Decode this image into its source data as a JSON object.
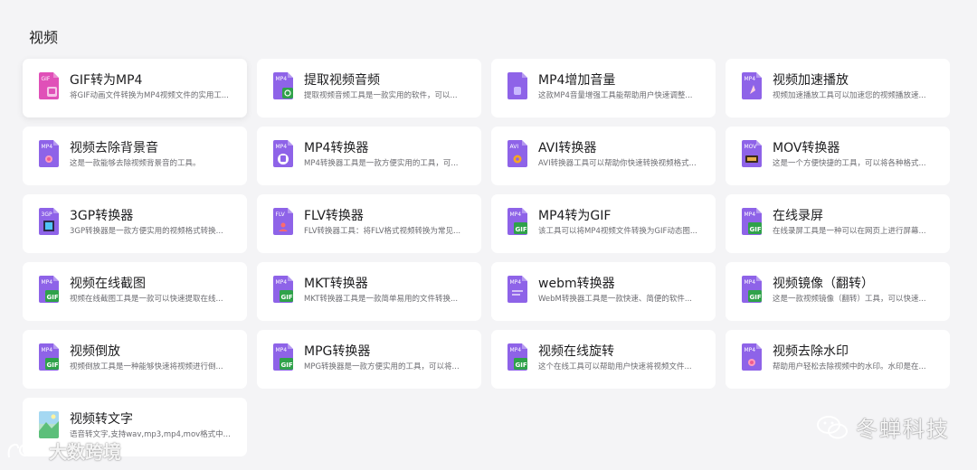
{
  "section": {
    "title": "视频"
  },
  "tools": [
    {
      "title": "GIF转为MP4",
      "desc": "将GIF动画文件转换为MP4视频文件的实用工...",
      "icon": "gif-to-mp4-icon",
      "badge": "GIF",
      "variant": "pink"
    },
    {
      "title": "提取视频音频",
      "desc": "提取视频音频工具是一款实用的软件，可以...",
      "icon": "extract-audio-icon",
      "badge": "MP4",
      "variant": "green-mark"
    },
    {
      "title": "MP4增加音量",
      "desc": "这款MP4音量增强工具能帮助用户快速调整...",
      "icon": "mp4-volume-icon",
      "badge": "",
      "variant": "volume"
    },
    {
      "title": "视频加速播放",
      "desc": "视频加速播放工具可以加速您的视频播放速...",
      "icon": "video-speed-icon",
      "badge": "MP4",
      "variant": "rocket"
    },
    {
      "title": "视频去除背景音",
      "desc": "这是一款能够去除视频背景音的工具。",
      "icon": "remove-bg-audio-icon",
      "badge": "MP4",
      "variant": "dot"
    },
    {
      "title": "MP4转换器",
      "desc": "MP4转换器工具是一款方便实用的工具，可...",
      "icon": "mp4-converter-icon",
      "badge": "MP4",
      "variant": "round"
    },
    {
      "title": "AVI转换器",
      "desc": "AVI转换器工具可以帮助你快速转换视频格式...",
      "icon": "avi-converter-icon",
      "badge": "AVI",
      "variant": "gear"
    },
    {
      "title": "MOV转换器",
      "desc": "这是一个方便快捷的工具，可以将各种格式...",
      "icon": "mov-converter-icon",
      "badge": "MOV",
      "variant": "film"
    },
    {
      "title": "3GP转换器",
      "desc": "3GP转换器是一款方便实用的视频格式转换...",
      "icon": "3gp-converter-icon",
      "badge": "3GP",
      "variant": "strip"
    },
    {
      "title": "FLV转换器",
      "desc": "FLV转换器工具：将FLV格式视频转换为常见...",
      "icon": "flv-converter-icon",
      "badge": "FLV",
      "variant": "person"
    },
    {
      "title": "MP4转为GIF",
      "desc": "该工具可以将MP4视频文件转换为GIF动态图...",
      "icon": "mp4-to-gif-icon",
      "badge": "MP4",
      "variant": "gif"
    },
    {
      "title": "在线录屏",
      "desc": "在线录屏工具是一种可以在网页上进行屏幕...",
      "icon": "screen-record-icon",
      "badge": "MP4",
      "variant": "gif"
    },
    {
      "title": "视频在线截图",
      "desc": "视频在线截图工具是一款可以快速提取在线...",
      "icon": "video-screenshot-icon",
      "badge": "MP4",
      "variant": "gif"
    },
    {
      "title": "MKT转换器",
      "desc": "MKT转换器工具是一款简单易用的文件转换...",
      "icon": "mkt-converter-icon",
      "badge": "MP4",
      "variant": "gif"
    },
    {
      "title": "webm转换器",
      "desc": "WebM转换器工具是一款快速、简便的软件...",
      "icon": "webm-converter-icon",
      "badge": "MP4",
      "variant": "plain"
    },
    {
      "title": "视频镜像（翻转）",
      "desc": "这是一款视频镜像（翻转）工具，可以快速...",
      "icon": "video-mirror-icon",
      "badge": "MP4",
      "variant": "gif"
    },
    {
      "title": "视频倒放",
      "desc": "视频倒放工具是一种能够快速将视频进行倒...",
      "icon": "video-reverse-icon",
      "badge": "MP4",
      "variant": "gif"
    },
    {
      "title": "MPG转换器",
      "desc": "MPG转换器是一款方便实用的工具，可以将...",
      "icon": "mpg-converter-icon",
      "badge": "MP4",
      "variant": "gif"
    },
    {
      "title": "视频在线旋转",
      "desc": "这个在线工具可以帮助用户快速将视频文件...",
      "icon": "video-rotate-icon",
      "badge": "MP4",
      "variant": "gif"
    },
    {
      "title": "视频去除水印",
      "desc": "帮助用户轻松去除视频中的水印。水印是在...",
      "icon": "remove-watermark-icon",
      "badge": "MP4",
      "variant": "dot"
    },
    {
      "title": "视频转文字",
      "desc": "语音转文字,支持wav,mp3,mp4,mov格式中...",
      "icon": "video-to-text-icon",
      "badge": "",
      "variant": "landscape"
    }
  ],
  "watermarks": {
    "left": "大数跨境",
    "right": "冬蝉科技"
  },
  "colors": {
    "background": "#f4f4f6",
    "card": "#ffffff",
    "icon_purple": "#8e63e8",
    "icon_green": "#2fa24a",
    "icon_pink": "#e050b8"
  }
}
